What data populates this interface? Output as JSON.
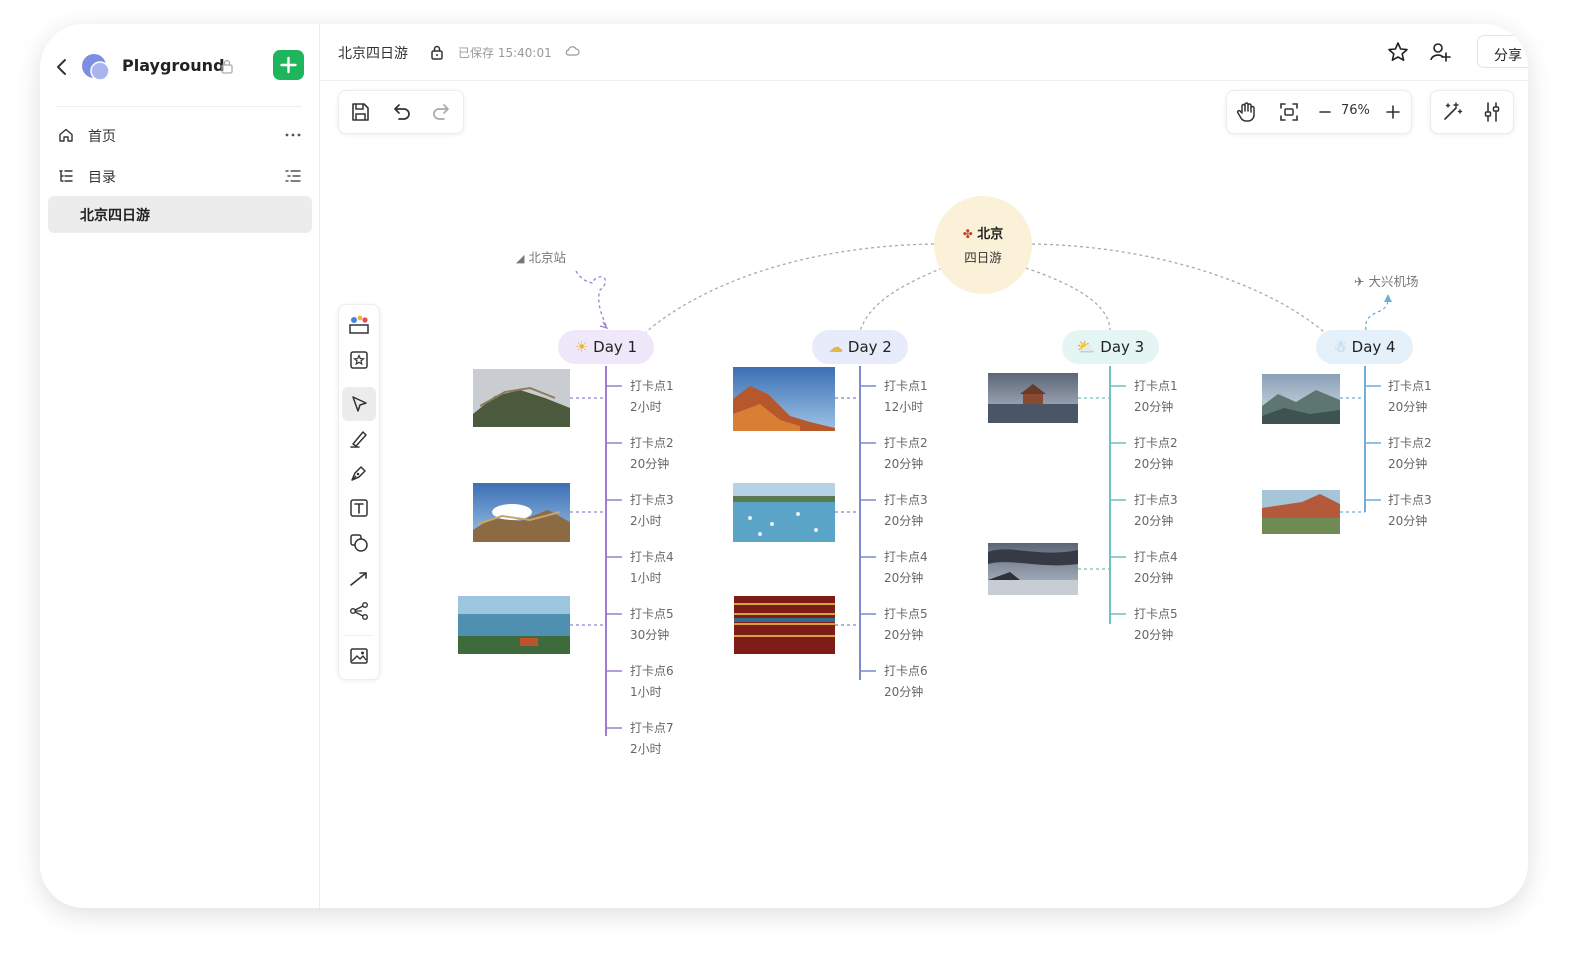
{
  "sidebar": {
    "space_name": "Playground",
    "nav": [
      {
        "label": "首页",
        "icon": "home-icon"
      },
      {
        "label": "目录",
        "icon": "toc-icon"
      }
    ],
    "doc_item": "北京四日游"
  },
  "topbar": {
    "doc_title": "北京四日游",
    "save_status": "已保存 15:40:01",
    "share_label": "分享"
  },
  "toolbar": {
    "zoom": "76%"
  },
  "mindmap": {
    "root_line1": "北京",
    "root_line2": "四日游",
    "start_station": "北京站",
    "end_station": "大兴机场",
    "days": [
      {
        "label": "Day 1",
        "weather": "sunny",
        "color": "#9b7fd4",
        "pill_bg": "#efe8fa",
        "stops": [
          {
            "name": "打卡点1",
            "time": "2小时"
          },
          {
            "name": "打卡点2",
            "time": "20分钟"
          },
          {
            "name": "打卡点3",
            "time": "2小时"
          },
          {
            "name": "打卡点4",
            "time": "1小时"
          },
          {
            "name": "打卡点5",
            "time": "30分钟"
          },
          {
            "name": "打卡点6",
            "time": "1小时"
          },
          {
            "name": "打卡点7",
            "time": "2小时"
          }
        ]
      },
      {
        "label": "Day 2",
        "weather": "cloudy",
        "color": "#7b89d0",
        "pill_bg": "#e8ecfa",
        "stops": [
          {
            "name": "打卡点1",
            "time": "12小时"
          },
          {
            "name": "打卡点2",
            "time": "20分钟"
          },
          {
            "name": "打卡点3",
            "time": "20分钟"
          },
          {
            "name": "打卡点4",
            "time": "20分钟"
          },
          {
            "name": "打卡点5",
            "time": "20分钟"
          },
          {
            "name": "打卡点6",
            "time": "20分钟"
          }
        ]
      },
      {
        "label": "Day 3",
        "weather": "partly-sunny",
        "color": "#6fc0c0",
        "pill_bg": "#e4f6f4",
        "stops": [
          {
            "name": "打卡点1",
            "time": "20分钟"
          },
          {
            "name": "打卡点2",
            "time": "20分钟"
          },
          {
            "name": "打卡点3",
            "time": "20分钟"
          },
          {
            "name": "打卡点4",
            "time": "20分钟"
          },
          {
            "name": "打卡点5",
            "time": "20分钟"
          }
        ]
      },
      {
        "label": "Day 4",
        "weather": "snowy",
        "color": "#6eaed8",
        "pill_bg": "#e4f1fa",
        "stops": [
          {
            "name": "打卡点1",
            "time": "20分钟"
          },
          {
            "name": "打卡点2",
            "time": "20分钟"
          },
          {
            "name": "打卡点3",
            "time": "20分钟"
          }
        ]
      }
    ]
  }
}
